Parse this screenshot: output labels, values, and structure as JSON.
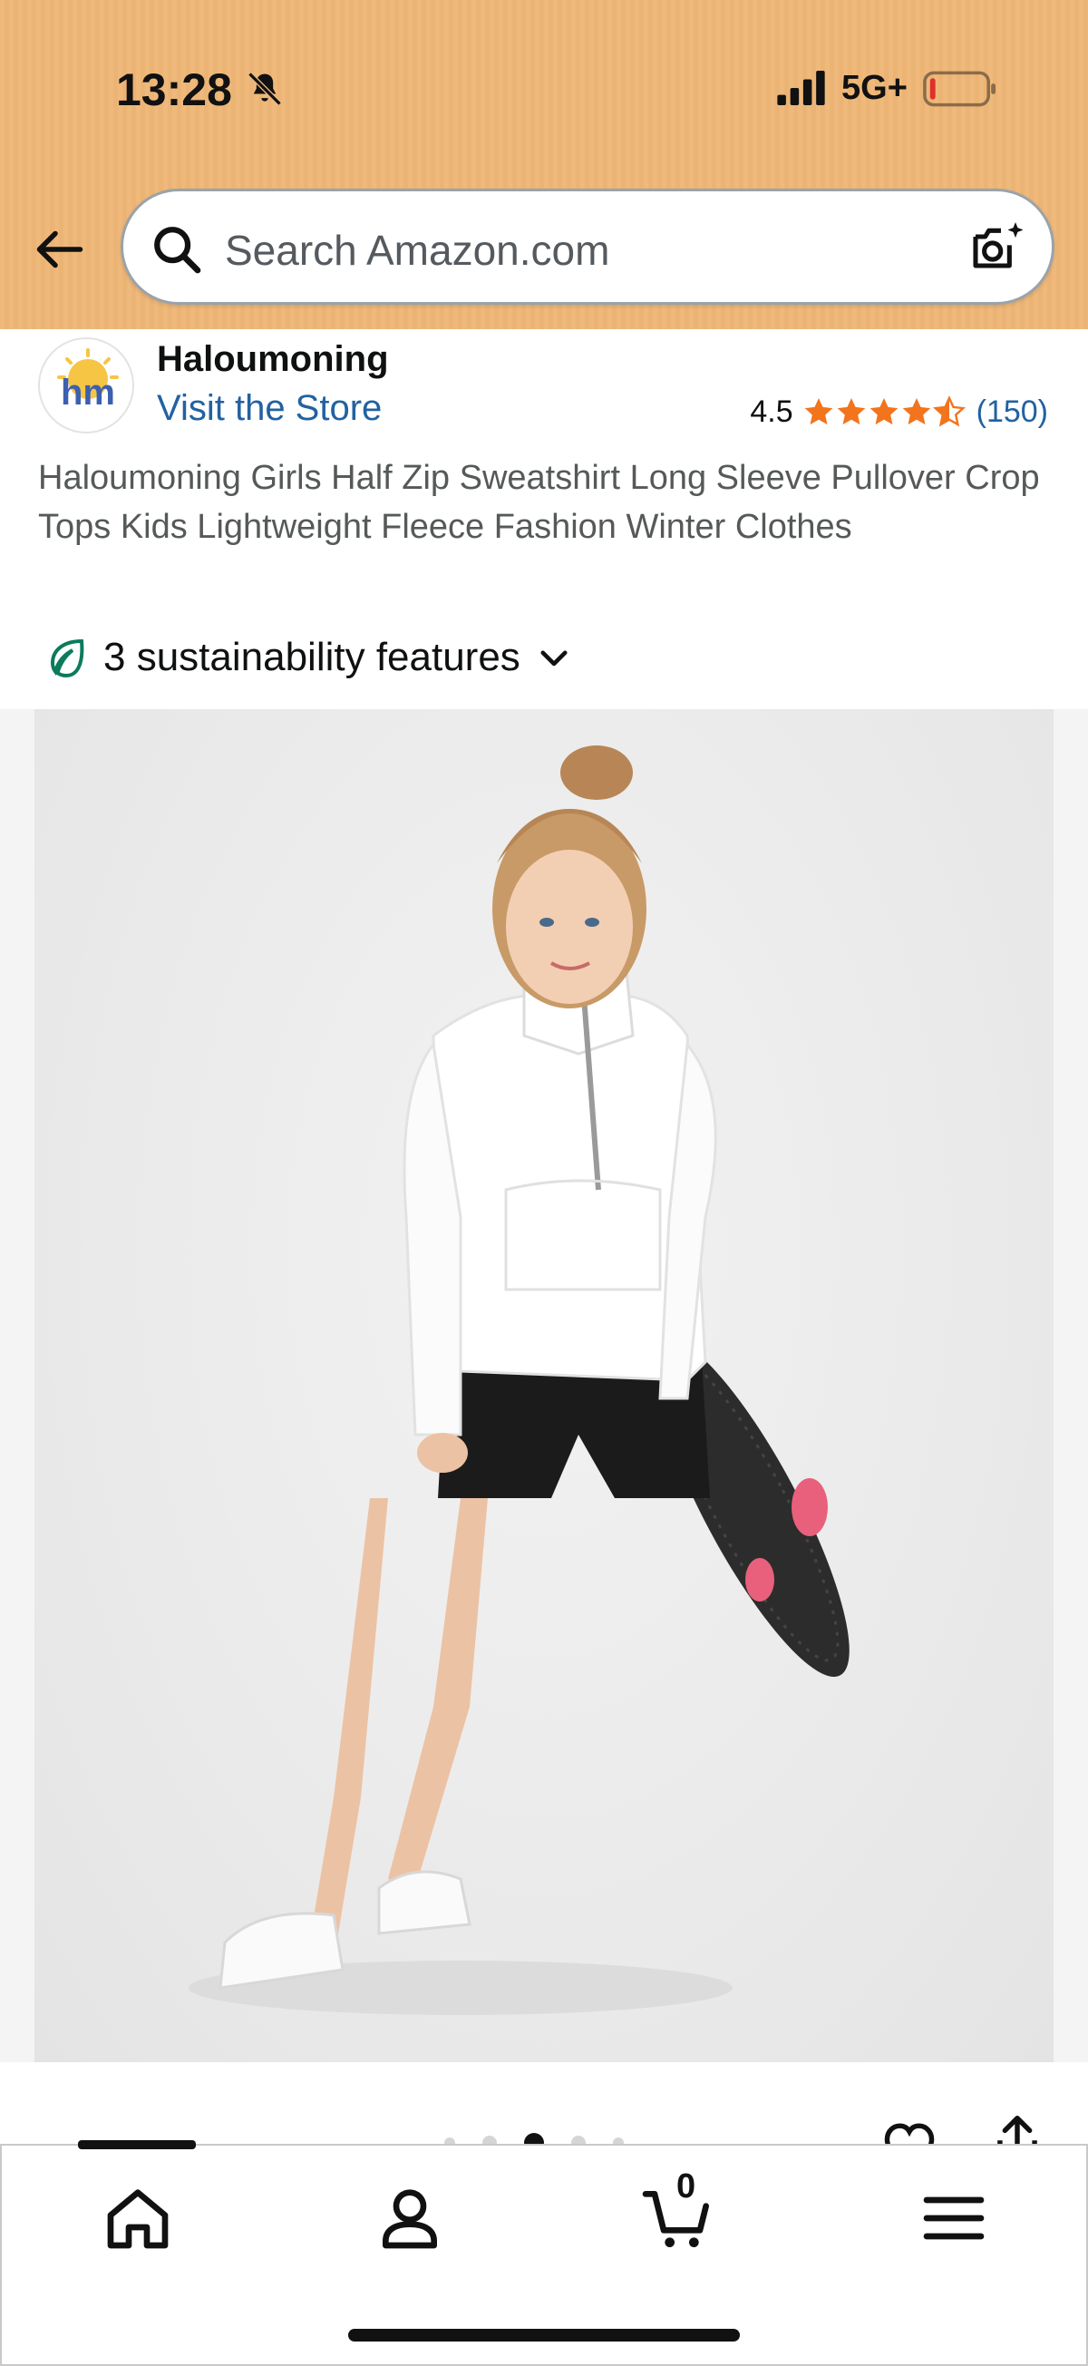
{
  "status_bar": {
    "time": "13:28",
    "network": "5G+"
  },
  "header": {
    "search_placeholder": "Search Amazon.com",
    "band_color": "#efb97c"
  },
  "brand": {
    "name": "Haloumoning",
    "visit_store": "Visit the Store",
    "logo_text": "hm"
  },
  "rating": {
    "value": "4.5",
    "stars": 4.5,
    "review_count": "(150)",
    "star_color": "#f2741c"
  },
  "product": {
    "title": "Haloumoning Girls Half Zip Sweatshirt Long Sleeve Pullover Crop Tops Kids Lightweight Fleece Fashion Winter Clothes",
    "image_alt": "Girl wearing white half zip sweatshirt and black shorts holding a black skateboard with pink wheels"
  },
  "sustainability": {
    "label": "3 sustainability features",
    "icon": "leaf-icon"
  },
  "carousel": {
    "total_visible_dots": 5,
    "active_index": 2
  },
  "bottom_nav": {
    "items": [
      {
        "name": "home",
        "icon": "home-icon"
      },
      {
        "name": "account",
        "icon": "person-icon"
      },
      {
        "name": "cart",
        "icon": "cart-icon"
      },
      {
        "name": "menu",
        "icon": "hamburger-icon"
      }
    ],
    "cart_count": "0"
  }
}
